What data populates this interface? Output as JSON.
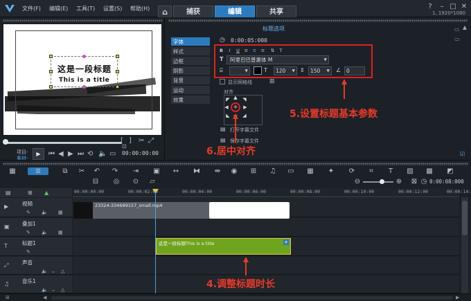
{
  "menu": {
    "file": "文件(F)",
    "edit": "编辑(E)",
    "tools": "工具(T)",
    "settings": "设置(S)",
    "help": "帮助(H)"
  },
  "tabs": {
    "capture": "捕获",
    "edit": "编辑",
    "share": "共享"
  },
  "resolution": "1, 1920*1080",
  "preview": {
    "title_cn": "这是一段标题",
    "title_en": "This is a title",
    "project_label": "项目-",
    "clip_label": "素材-",
    "timecode": "00:00:00:00"
  },
  "options": {
    "header": "标题选项",
    "duration": "0:00:05:000",
    "side_tabs": [
      "字体",
      "样式",
      "边框",
      "阴影",
      "背景",
      "运动",
      "效果"
    ],
    "font_name": "阿里巴巴普惠体 M",
    "font_size": "120",
    "line_spacing": "150",
    "angle": "0",
    "show_grid": "显示网格线",
    "align_label": "对齐",
    "open_subtitle": "打开字幕文件",
    "save_subtitle": "保存字幕文件"
  },
  "annotations": {
    "step5": "5.设置标题基本参数",
    "step6": "6.居中对齐",
    "step4": "4.调整标题时长"
  },
  "timeline": {
    "zoom_time": "0:00:08:000",
    "ruler": [
      "00:00:00:00",
      "00:00:02:00",
      "00:00:04:00",
      "00:00:06:00",
      "00:00:08:00",
      "00:00:10:00",
      "00:00:12:00",
      "00:00:14:00"
    ],
    "tracks": [
      {
        "name": "视频"
      },
      {
        "name": "叠加1"
      },
      {
        "name": "标题1"
      },
      {
        "name": "声音"
      },
      {
        "name": "音乐1"
      }
    ],
    "video_clip_name": "23324-334689157_small.mp4",
    "title_clip_text": "这是一段标题This is a title"
  },
  "colors": {
    "accent": "#2c7bbf",
    "title_clip": "#6fa41f",
    "annotation": "#e83a28",
    "handle_green": "#b9e22b",
    "handle_magenta": "#c94fd2"
  }
}
